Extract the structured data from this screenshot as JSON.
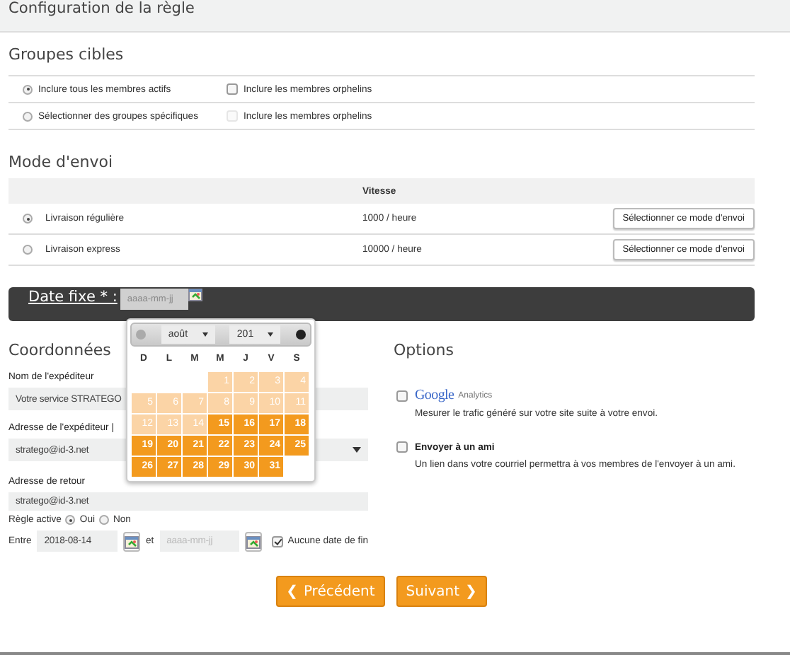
{
  "header": {
    "title": "Configuration de la règle"
  },
  "target_groups": {
    "title": "Groupes cibles",
    "rows": [
      {
        "label": "Inclure tous les membres actifs",
        "selected": true,
        "orphans": {
          "label": "Inclure les membres orphelins",
          "checked": false,
          "disabled": false
        }
      },
      {
        "label": "Sélectionner des groupes spécifiques",
        "selected": false,
        "orphans": {
          "label": "Inclure les membres orphelins",
          "checked": false,
          "disabled": true
        }
      }
    ]
  },
  "send_mode": {
    "title": "Mode d'envoi",
    "column": "Vitesse",
    "rows": [
      {
        "name": "Livraison régulière",
        "speed": "1000 / heure",
        "selected": true,
        "button": "Sélectionner ce mode d'envoi"
      },
      {
        "name": "Livraison express",
        "speed": "10000 / heure",
        "selected": false,
        "button": "Sélectionner ce mode d'envoi"
      }
    ]
  },
  "fixed_date": {
    "label": "Date fixe * :",
    "placeholder": "aaaa-mm-jj"
  },
  "calendar": {
    "month": "août",
    "year": "201",
    "weekdays": [
      "D",
      "L",
      "M",
      "M",
      "J",
      "V",
      "S"
    ],
    "weeks": [
      {
        "days": [
          {
            "day": "1",
            "disabled": true
          },
          {
            "day": "2",
            "disabled": true
          },
          {
            "day": "3",
            "disabled": true
          },
          {
            "day": "4",
            "disabled": true
          }
        ]
      },
      {
        "days": [
          {
            "day": "5",
            "disabled": true
          },
          {
            "day": "6",
            "disabled": true
          },
          {
            "day": "7",
            "disabled": true
          },
          {
            "day": "8",
            "disabled": true
          },
          {
            "day": "9",
            "disabled": true
          },
          {
            "day": "10",
            "disabled": true
          },
          {
            "day": "11",
            "disabled": true
          }
        ]
      },
      {
        "days": [
          {
            "day": "12",
            "disabled": true
          },
          {
            "day": "13",
            "disabled": true
          },
          {
            "day": "14",
            "disabled": true
          },
          {
            "day": "15",
            "disabled": false
          },
          {
            "day": "16",
            "disabled": false
          },
          {
            "day": "17",
            "disabled": false
          },
          {
            "day": "18",
            "disabled": false
          }
        ]
      },
      {
        "days": [
          {
            "day": "19",
            "disabled": false
          },
          {
            "day": "20",
            "disabled": false
          },
          {
            "day": "21",
            "disabled": false
          },
          {
            "day": "22",
            "disabled": false
          },
          {
            "day": "23",
            "disabled": false
          },
          {
            "day": "24",
            "disabled": false
          },
          {
            "day": "25",
            "disabled": false
          }
        ]
      },
      {
        "days": [
          {
            "day": "26",
            "disabled": false
          },
          {
            "day": "27",
            "disabled": false
          },
          {
            "day": "28",
            "disabled": false
          },
          {
            "day": "29",
            "disabled": false
          },
          {
            "day": "30",
            "disabled": false
          },
          {
            "day": "31",
            "disabled": false
          }
        ]
      }
    ]
  },
  "contact": {
    "title": "Coordonnées",
    "sender_name": {
      "label": "Nom de l'expéditeur",
      "value": "Votre service STRATEGO"
    },
    "sender_address": {
      "label": "Adresse de l'expéditeur |",
      "value": "stratego@id-3.net"
    },
    "return_address": {
      "label": "Adresse de retour",
      "value": "stratego@id-3.net"
    },
    "active": {
      "label": "Règle active",
      "options": [
        {
          "label": "Oui",
          "selected": true
        },
        {
          "label": "Non",
          "selected": false
        }
      ]
    },
    "period": {
      "from_label": "Entre",
      "from_value": "2018-08-14",
      "and_label": "et",
      "to_placeholder": "aaaa-mm-jj",
      "no_end": {
        "label": "Aucune date de fin",
        "checked": true
      }
    }
  },
  "options": {
    "title": "Options",
    "items": [
      {
        "kind": "brand",
        "brand": "Google",
        "label": "Analytics",
        "description": "Mesurer le trafic généré sur votre site suite à votre envoi.",
        "checked": false
      },
      {
        "kind": "plain",
        "label": "Envoyer à un ami",
        "description": "Un lien dans votre courriel permettra à vos membres de l'envoyer à un ami.",
        "checked": false
      }
    ]
  },
  "nav": [
    {
      "kind": "prev",
      "icon": "❮",
      "label": "Précédent"
    },
    {
      "kind": "next",
      "icon": "❯",
      "label": "Suivant"
    }
  ]
}
